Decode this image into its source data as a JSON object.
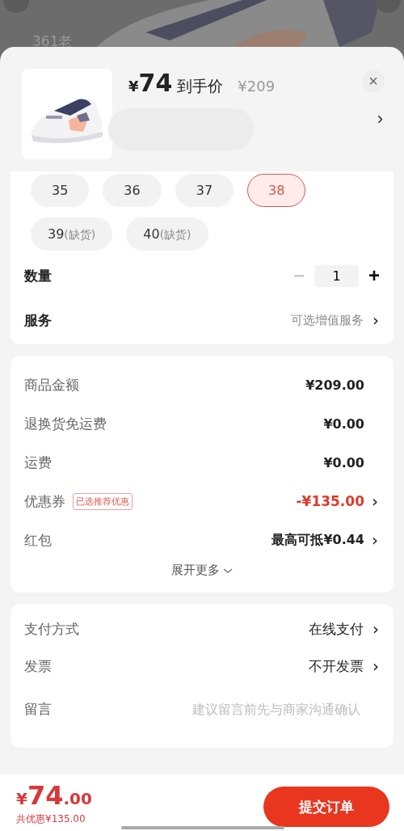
{
  "backdrop": {
    "kind": "picture",
    "search_hint": "361老"
  },
  "header": {
    "currency": "¥",
    "price": "74",
    "price_label": "到手价",
    "original_price": "¥209",
    "close": "×",
    "more": "›"
  },
  "sizes": [
    {
      "label": "35",
      "selected": false
    },
    {
      "label": "36",
      "selected": false
    },
    {
      "label": "37",
      "selected": false
    },
    {
      "label": "38",
      "selected": true
    },
    {
      "label": "39",
      "note": "(缺货)",
      "selected": false
    },
    {
      "label": "40",
      "note": "(缺货)",
      "selected": false
    }
  ],
  "quantity": {
    "label": "数量",
    "minus": "−",
    "value": "1",
    "plus": "+",
    "minus_disabled": true
  },
  "service": {
    "label": "服务",
    "value": "可选增值服务",
    "arrow": "›"
  },
  "costs": [
    {
      "label": "商品金额",
      "value": "¥209.00",
      "kind": "plain"
    },
    {
      "label": "退换货免运费",
      "value": "¥0.00",
      "kind": "plain"
    },
    {
      "label": "运费",
      "value": "¥0.00",
      "kind": "plain"
    },
    {
      "label": "优惠券",
      "tag": "已选推荐优惠",
      "value": "-¥135.00",
      "kind": "discount",
      "arrow": "›"
    },
    {
      "label": "红包",
      "value": "最高可抵¥0.44",
      "kind": "plain",
      "arrow": "›"
    }
  ],
  "expand": "展开更多",
  "options": [
    {
      "label": "支付方式",
      "value": "在线支付",
      "kind": "select",
      "arrow": "›"
    },
    {
      "label": "发票",
      "value": "不开发票",
      "kind": "select",
      "arrow": "›"
    },
    {
      "label": "留言",
      "placeholder": "建议留言前先与商家沟通确认",
      "kind": "input"
    }
  ],
  "footer": {
    "currency": "¥",
    "total_int": "74",
    "total_dec": ".00",
    "saved": "共优惠¥135.00",
    "submit": "提交订单"
  }
}
